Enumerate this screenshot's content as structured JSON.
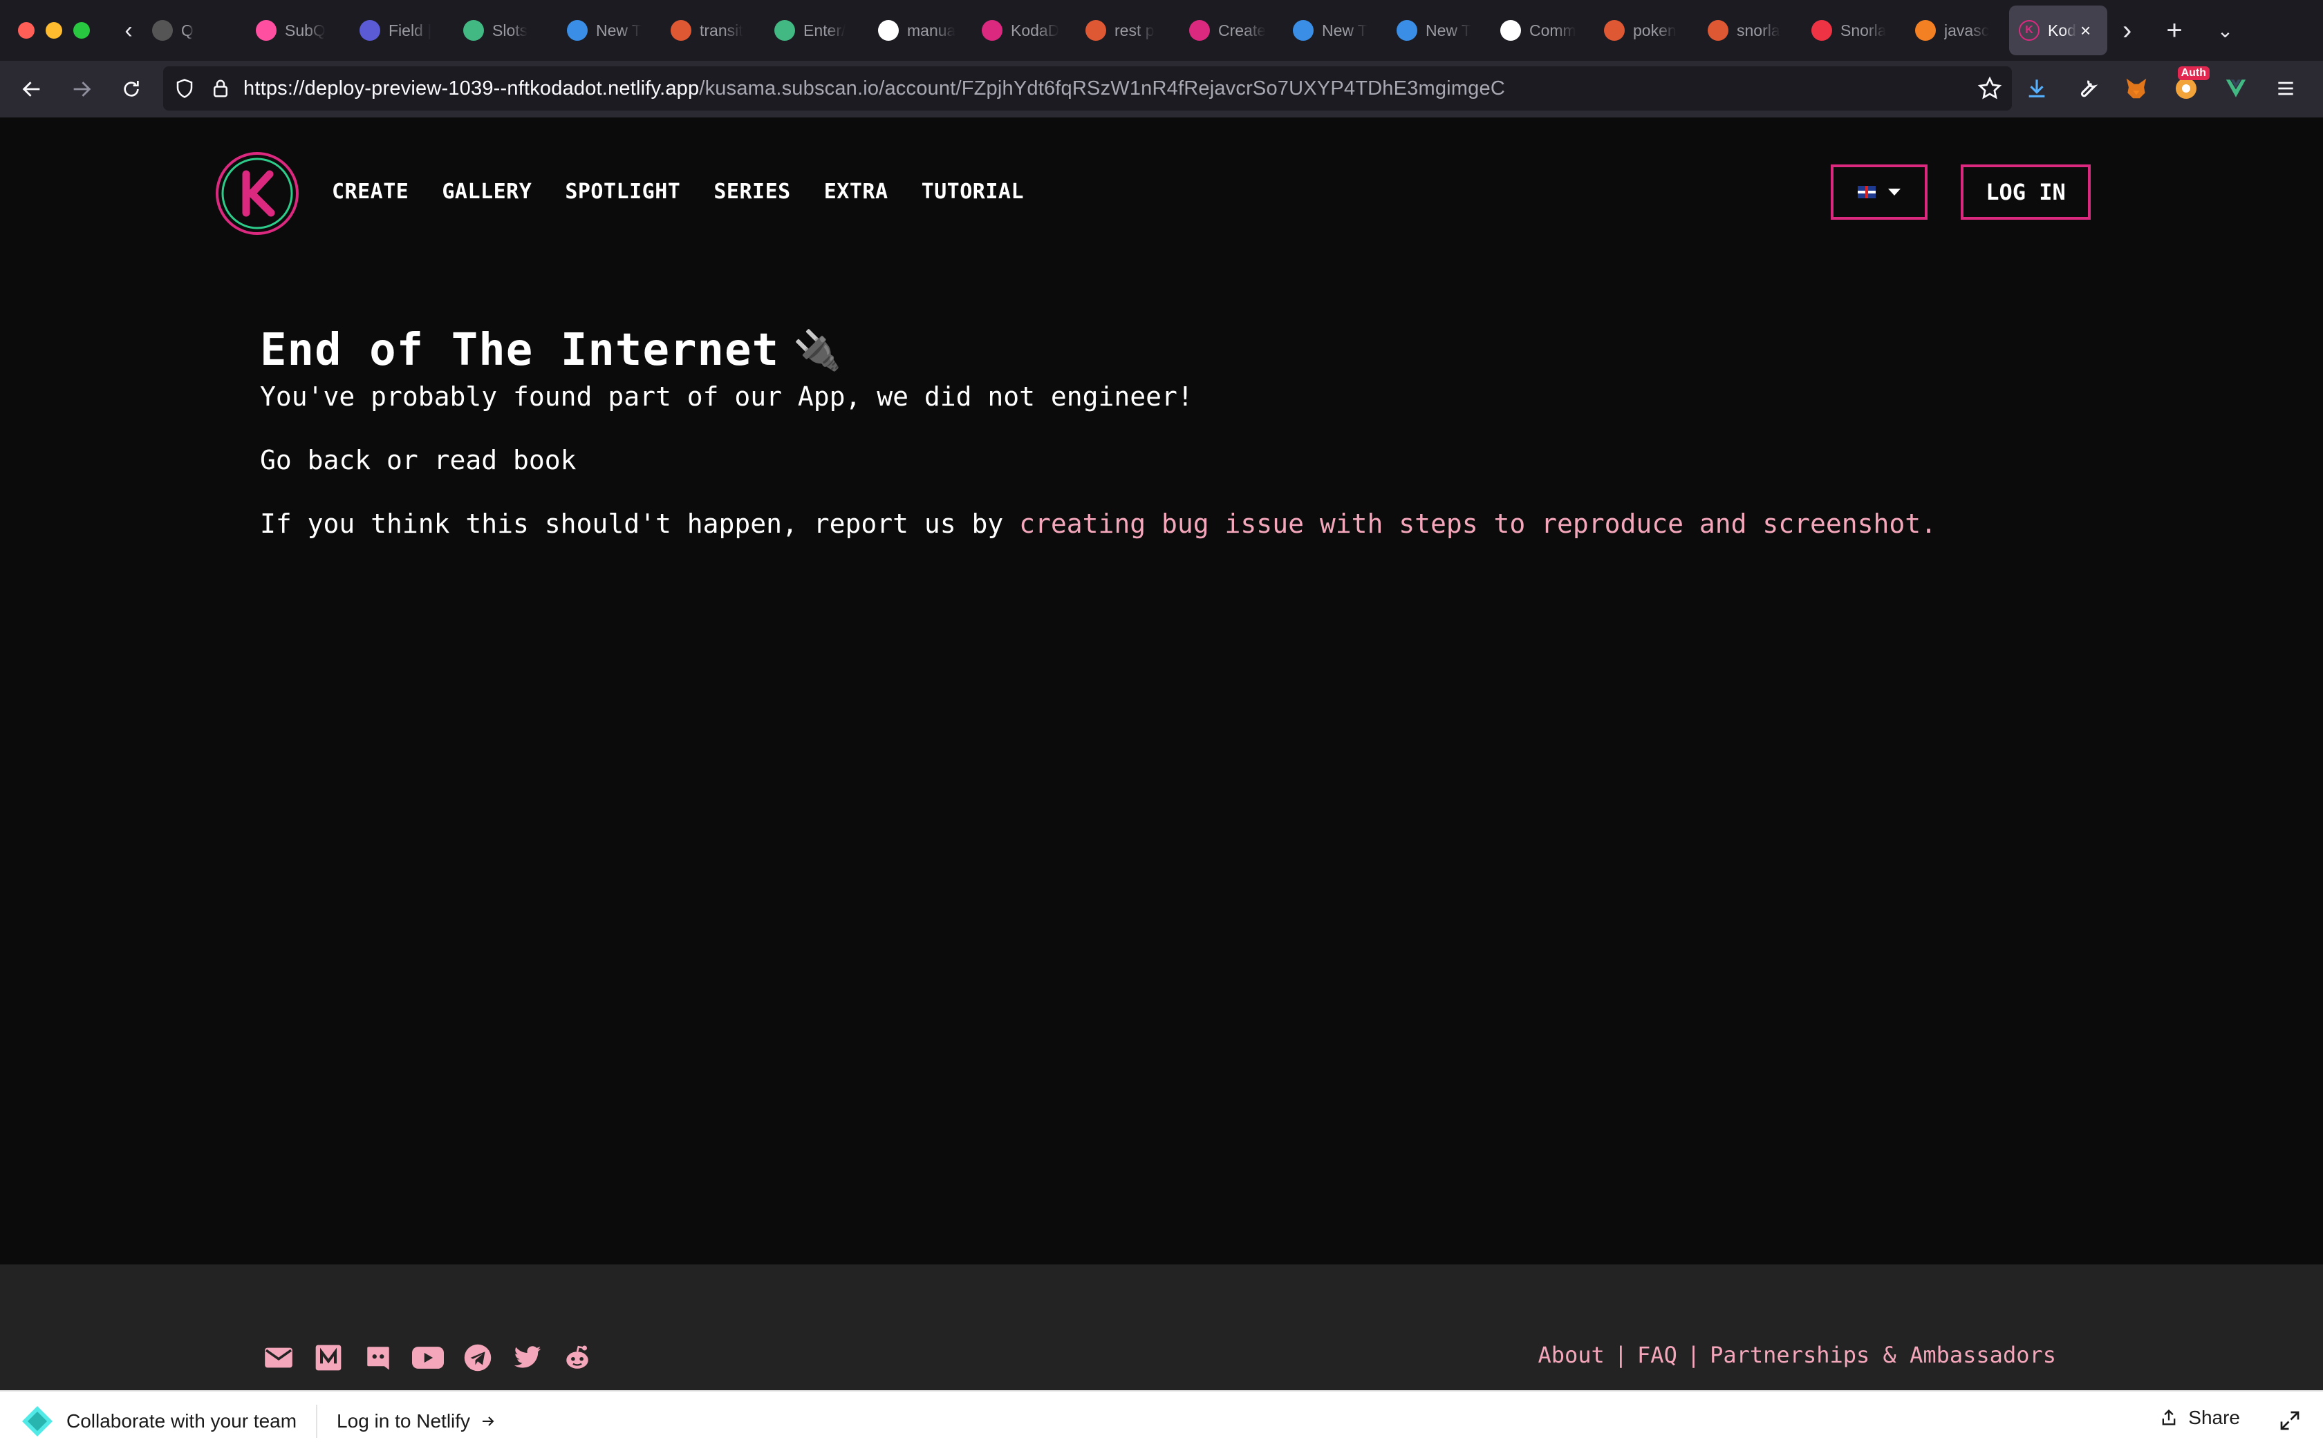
{
  "browser": {
    "tabs": [
      {
        "label": "Q",
        "favicon": "partial-icon",
        "color": "#555"
      },
      {
        "label": "SubQ",
        "favicon": "subquery-icon",
        "color": "#ff4fa0"
      },
      {
        "label": "Field |",
        "favicon": "b-icon",
        "color": "#5b5bd6"
      },
      {
        "label": "Slots",
        "favicon": "vue-icon",
        "color": "#42b883"
      },
      {
        "label": "New T",
        "favicon": "firefox-icon",
        "color": "#3a8ee6"
      },
      {
        "label": "transit",
        "favicon": "duckduckgo-icon",
        "color": "#de5833"
      },
      {
        "label": "Enter/",
        "favicon": "vue-icon",
        "color": "#42b883"
      },
      {
        "label": "manua",
        "favicon": "github-icon",
        "color": "#fff"
      },
      {
        "label": "KodaD",
        "favicon": "kodadot-icon",
        "color": "#db2980"
      },
      {
        "label": "rest p",
        "favicon": "duckduckgo-icon",
        "color": "#de5833"
      },
      {
        "label": "Create",
        "favicon": "s-icon",
        "color": "#db2980"
      },
      {
        "label": "New T",
        "favicon": "firefox-icon",
        "color": "#3a8ee6"
      },
      {
        "label": "New T",
        "favicon": "firefox-icon",
        "color": "#3a8ee6"
      },
      {
        "label": "Comm",
        "favicon": "wikipedia-icon",
        "color": "#fff"
      },
      {
        "label": "poken",
        "favicon": "duckduckgo-icon",
        "color": "#de5833"
      },
      {
        "label": "snorla",
        "favicon": "duckduckgo-icon",
        "color": "#de5833"
      },
      {
        "label": "Snorla",
        "favicon": "pokeball-icon",
        "color": "#e34"
      },
      {
        "label": "javasc",
        "favicon": "stackoverflow-icon",
        "color": "#f48024"
      }
    ],
    "active_tab": {
      "label": "Kod",
      "favicon": "kodadot-icon"
    },
    "url_host": "https://deploy-preview-1039--nftkodadot.netlify.app",
    "url_path": "/kusama.subscan.io/account/FZpjhYdt6fqRSzW1nR4fRejavcrSo7UXYP4TDhE3mgimgeC",
    "extension_badge": "Auth"
  },
  "header": {
    "nav": [
      "CREATE",
      "GALLERY",
      "SPOTLIGHT",
      "SERIES",
      "EXTRA",
      "TUTORIAL"
    ],
    "login_label": "LOG IN",
    "accent": "#db2980"
  },
  "content": {
    "title": "End of The Internet",
    "emoji": "🔌",
    "subtitle": "You've probably found part of our App, we did not engineer!",
    "goback": "Go back or read book",
    "report_prefix": "If you think this should't happen, report us by ",
    "report_link": "creating bug issue with steps to reproduce and screenshot.",
    "link_color": "#f4a6bb"
  },
  "footer": {
    "social_icons": [
      "email-icon",
      "medium-icon",
      "discord-icon",
      "youtube-icon",
      "telegram-icon",
      "twitter-icon",
      "reddit-icon"
    ],
    "links": [
      "About",
      "FAQ",
      "Partnerships & Ambassadors"
    ]
  },
  "netlify_drawer": {
    "collab": "Collaborate with your team",
    "login": "Log in to Netlify",
    "share": "Share"
  }
}
